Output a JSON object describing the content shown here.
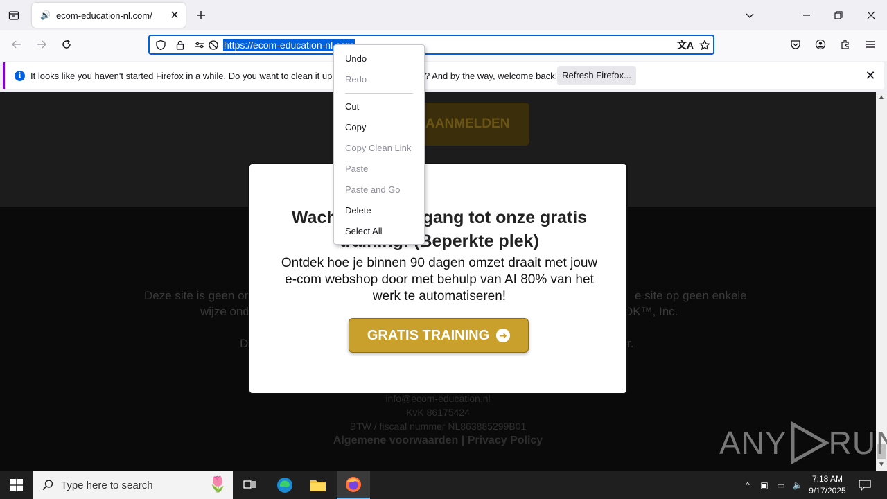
{
  "browser": {
    "tab_title": "ecom-education-nl.com/",
    "url": "https://ecom-education-nl.com",
    "url_visible": "https://ecom-education-nl.com"
  },
  "notification": {
    "message_left": "It looks like you haven't started Firefox in a while. Do you want to clean it up for a fr",
    "message_right": "? And by the way, welcome back!",
    "refresh_label": "Refresh Firefox..."
  },
  "context_menu": {
    "items": [
      {
        "label": "Undo",
        "enabled": true
      },
      {
        "label": "Redo",
        "enabled": false
      },
      {
        "label": "Cut",
        "enabled": true
      },
      {
        "label": "Copy",
        "enabled": true
      },
      {
        "label": "Copy Clean Link",
        "enabled": false
      },
      {
        "label": "Paste",
        "enabled": false
      },
      {
        "label": "Paste and Go",
        "enabled": false
      },
      {
        "label": "Delete",
        "enabled": true
      },
      {
        "label": "Select All",
        "enabled": true
      }
    ]
  },
  "page": {
    "top_button": "AANMELDEN",
    "disclaimer_left_1": "Deze site is geen onc",
    "disclaimer_right_1": "e site op geen enkele",
    "disclaimer_left_2": "wijze ond",
    "disclaimer_right_2": "OK™, Inc.",
    "disclaimer_left_3": "D",
    "disclaimer_right_3": "r.",
    "email": "info@ecom-education.nl",
    "kvk": "KvK 86175424",
    "btw": "BTW / fiscaal nummer NL863885299B01",
    "terms": "Algemene voorwaarden",
    "separator": "|",
    "privacy": "Privacy Policy"
  },
  "modal": {
    "headline_line1_left": "Wach",
    "headline_line1_right": "gang tot onze gratis",
    "headline_line2": "training! (Beperkte plek)",
    "subtext": "Ontdek hoe je binnen 90 dagen omzet draait met jouw e-com webshop door met behulp van AI 80% van het werk te automatiseren!",
    "cta_label": "GRATIS TRAINING"
  },
  "watermark": {
    "text_left": "ANY",
    "text_right": "RUN"
  },
  "taskbar": {
    "search_placeholder": "Type here to search",
    "time": "7:18 AM",
    "date": "9/17/2025"
  },
  "colors": {
    "accent_blue": "#0060df",
    "cta_gold": "#c9a02c",
    "notification_bar": "#8000d7"
  }
}
